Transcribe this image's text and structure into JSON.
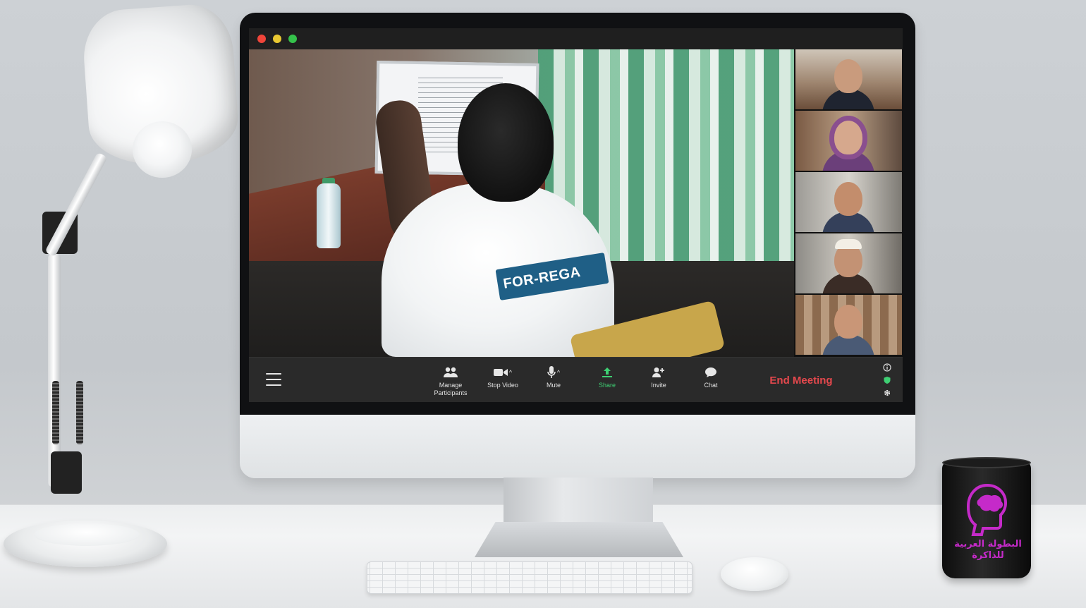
{
  "window": {
    "controls": [
      "close",
      "minimize",
      "maximize"
    ]
  },
  "speaker_view": {
    "hoodie_text": "FOR-REGA"
  },
  "gallery": {
    "participant_count": 5
  },
  "toolbar": {
    "menu_icon": "hamburger-icon",
    "buttons": [
      {
        "label": "Manage\nParticipants",
        "icon": "participants-icon"
      },
      {
        "label": "Stop Video",
        "icon": "video-camera-icon",
        "has_caret": true
      },
      {
        "label": "Mute",
        "icon": "microphone-icon",
        "has_caret": true
      },
      {
        "label": "Share",
        "icon": "share-up-arrow-icon",
        "color": "#3ecf73"
      },
      {
        "label": "Invite",
        "icon": "add-user-icon"
      },
      {
        "label": "Chat",
        "icon": "chat-bubble-icon"
      }
    ],
    "end_meeting": "End Meeting",
    "end_meeting_color": "#e5484d",
    "side_icons": [
      "info-icon",
      "shield-icon",
      "gear-icon"
    ]
  },
  "mug": {
    "text": "البطولة العربية للذاكرة",
    "accent": "#c52ac9"
  }
}
